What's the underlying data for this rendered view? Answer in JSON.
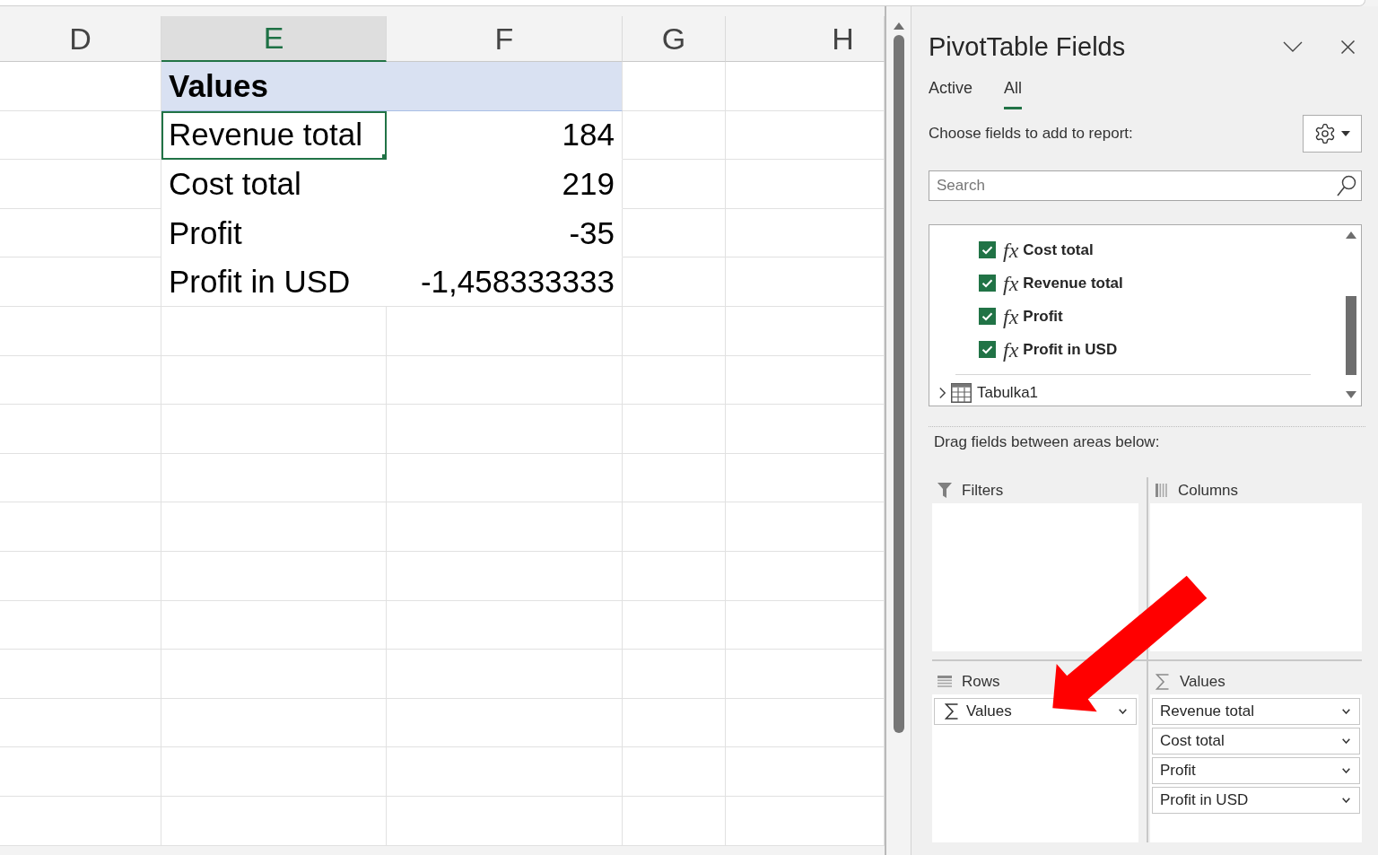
{
  "sheet": {
    "columns": [
      {
        "label": "D",
        "selected": false
      },
      {
        "label": "E",
        "selected": true
      },
      {
        "label": "F",
        "selected": false
      },
      {
        "label": "G",
        "selected": false
      },
      {
        "label": "H",
        "selected": false
      }
    ],
    "pivot": {
      "header": "Values",
      "rows": [
        {
          "label": "Revenue total",
          "value": "184",
          "selected": true
        },
        {
          "label": "Cost total",
          "value": "219",
          "selected": false
        },
        {
          "label": "Profit",
          "value": "-35",
          "selected": false
        },
        {
          "label": "Profit in USD",
          "value": "-1,458333333",
          "selected": false
        }
      ]
    }
  },
  "panel": {
    "title": "PivotTable Fields",
    "tabs": [
      {
        "label": "Active",
        "selected": false
      },
      {
        "label": "All",
        "selected": true
      }
    ],
    "choose_label": "Choose fields to add to report:",
    "search": {
      "placeholder": "Search"
    },
    "fields": [
      {
        "symbol": "fx",
        "name": "Cost total",
        "checked": true
      },
      {
        "symbol": "fx",
        "name": "Revenue total",
        "checked": true
      },
      {
        "symbol": "fx",
        "name": "Profit",
        "checked": true
      },
      {
        "symbol": "fx",
        "name": "Profit in USD",
        "checked": true
      }
    ],
    "table_group": {
      "name": "Tabulka1",
      "expanded": false
    },
    "drag_label": "Drag fields between areas below:",
    "areas": [
      {
        "kind": "filters",
        "label": "Filters"
      },
      {
        "kind": "columns",
        "label": "Columns"
      },
      {
        "kind": "rows",
        "label": "Rows",
        "items": [
          {
            "kind": "sigma",
            "label": "Values"
          }
        ]
      },
      {
        "kind": "values",
        "label": "Values",
        "items": [
          {
            "kind": "field",
            "label": "Revenue total"
          },
          {
            "kind": "field",
            "label": "Cost total"
          },
          {
            "kind": "field",
            "label": "Profit"
          },
          {
            "kind": "field",
            "label": "Profit in USD"
          }
        ]
      }
    ]
  }
}
